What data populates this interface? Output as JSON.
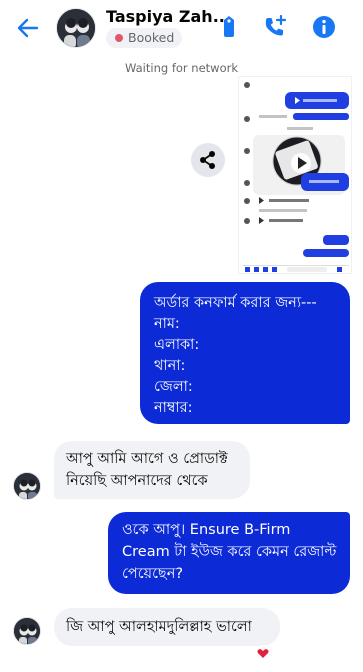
{
  "header": {
    "contact_name": "Taspiya Zah...",
    "status_label": "Booked",
    "status_color": "#e4566a",
    "accent_color": "#1877f2",
    "icons": [
      "back-arrow-icon",
      "label-tag-icon",
      "add-call-icon",
      "info-icon"
    ]
  },
  "connection_status": "Waiting for network",
  "attachment": {
    "type": "screenshot",
    "action_icon": "share-icon"
  },
  "messages": [
    {
      "direction": "outgoing",
      "lines": [
        "অর্ডার কনফার্ম করার জন্য---",
        "নাম:",
        "এলাকা:",
        "থানা:",
        "জেলা:",
        "নাম্বার:"
      ]
    },
    {
      "direction": "incoming",
      "text": "আপু আমি আগে ও প্রোডাক্ট নিয়েছি আপনাদের থেকে"
    },
    {
      "direction": "outgoing",
      "text": "ওকে আপু। Ensure B-Firm Cream টা ইউজ করে কেমন রেজাল্ট পেয়েছেন?"
    },
    {
      "direction": "incoming",
      "text": "জি আপু আলহামদুলিল্লাহ ভালো",
      "reaction": "heart"
    }
  ],
  "colors": {
    "outgoing_bubble": "#0c2bd7",
    "incoming_bubble": "#f0f2f5",
    "reaction": "#e41e3f"
  }
}
